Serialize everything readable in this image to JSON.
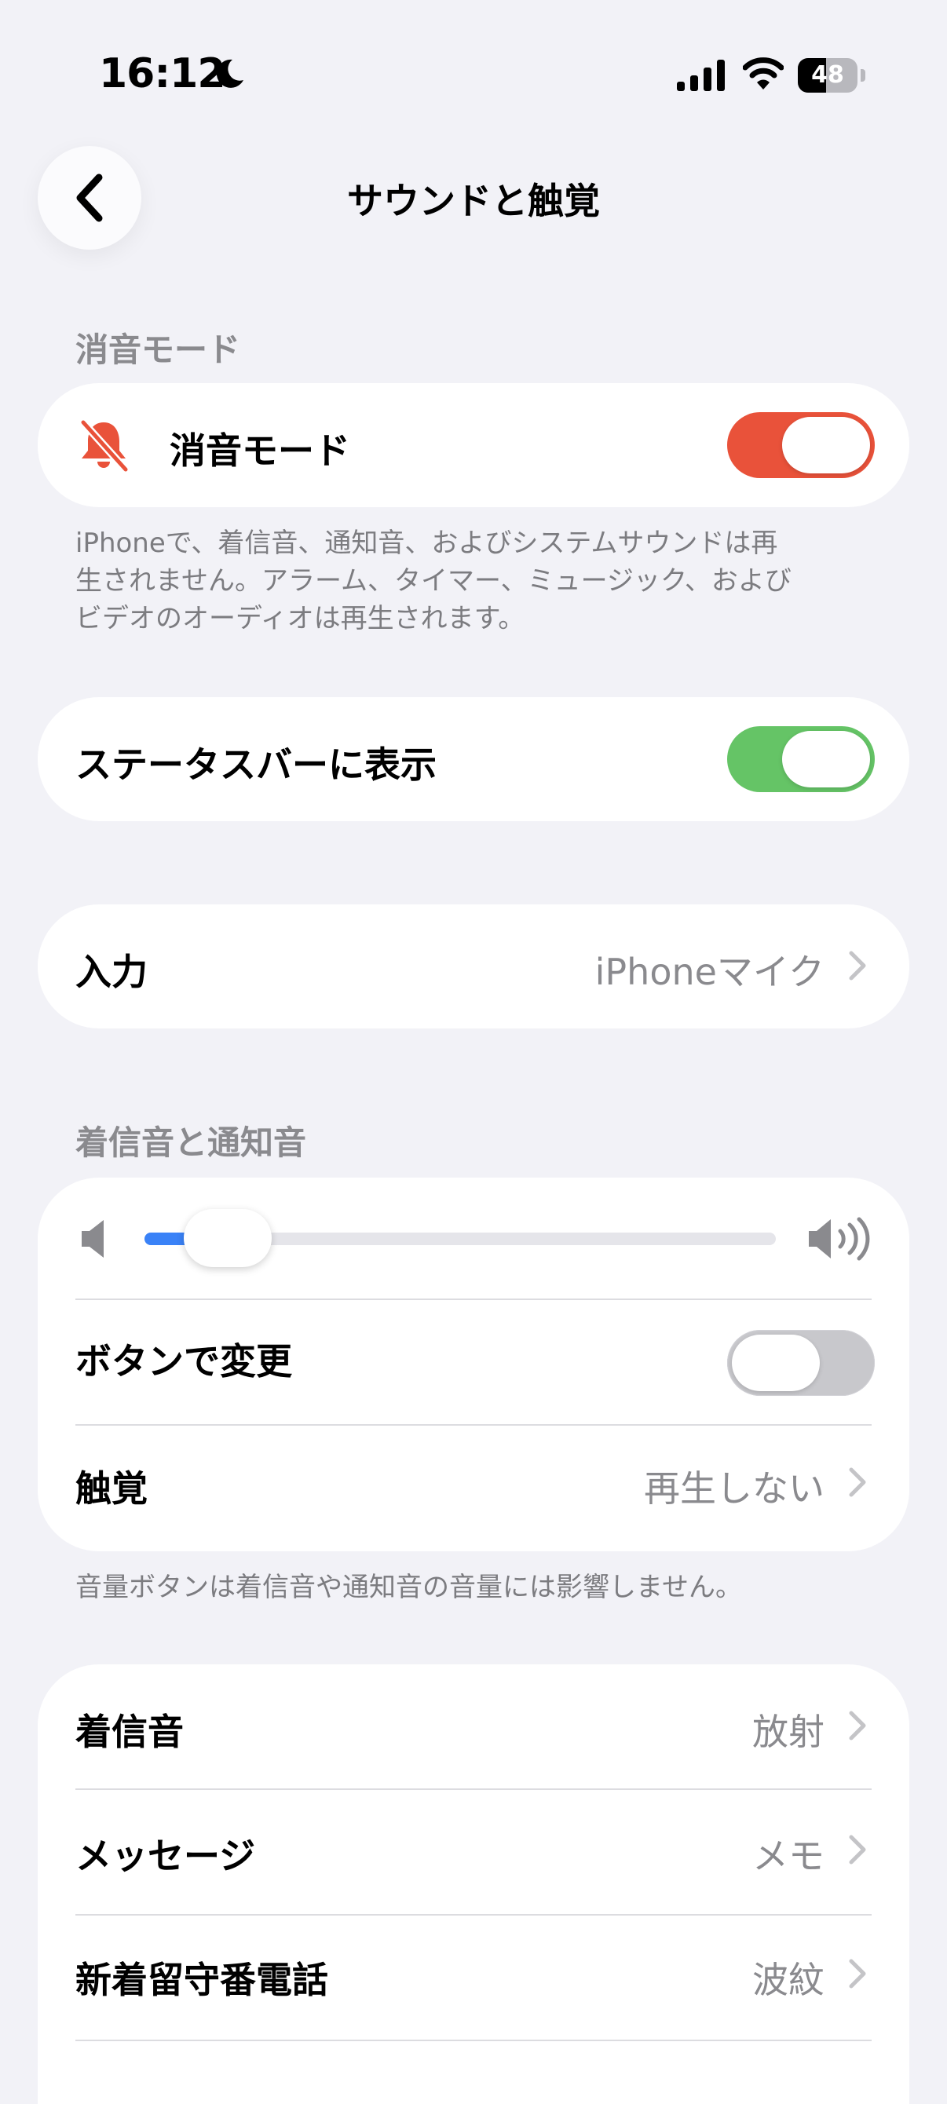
{
  "status_bar": {
    "time": "16:12",
    "battery": "48",
    "battery_level": 0.48
  },
  "nav": {
    "title": "サウンドと触覚",
    "back_icon": "chevron-left-icon"
  },
  "silent_mode": {
    "header": "消音モード",
    "label": "消音モード",
    "icon": "bell-slash-icon",
    "on": true,
    "accent": "#E9523A",
    "footnote_lines": [
      "iPhoneで、着信音、通知音、およびシステムサウンドは再",
      "生されません。アラーム、タイマー、ミュージック、および",
      "ビデオのオーディオは再生されます。"
    ]
  },
  "status_bar_toggle": {
    "label": "ステータスバーに表示",
    "on": true,
    "accent": "#65C466"
  },
  "input": {
    "label": "入力",
    "value": "iPhoneマイク"
  },
  "ringer": {
    "header": "着信音と通知音",
    "volume_level": 0.1,
    "slider_accent": "#3A82F7",
    "change_with_buttons": {
      "label": "ボタンで変更",
      "on": false
    },
    "haptics": {
      "label": "触覚",
      "value": "再生しない"
    },
    "footnote": "音量ボタンは着信音や通知音の音量には影響しません。"
  },
  "sounds": [
    {
      "label": "着信音",
      "value": "放射"
    },
    {
      "label": "メッセージ",
      "value": "メモ"
    },
    {
      "label": "新着留守番電話",
      "value": "波紋"
    }
  ]
}
